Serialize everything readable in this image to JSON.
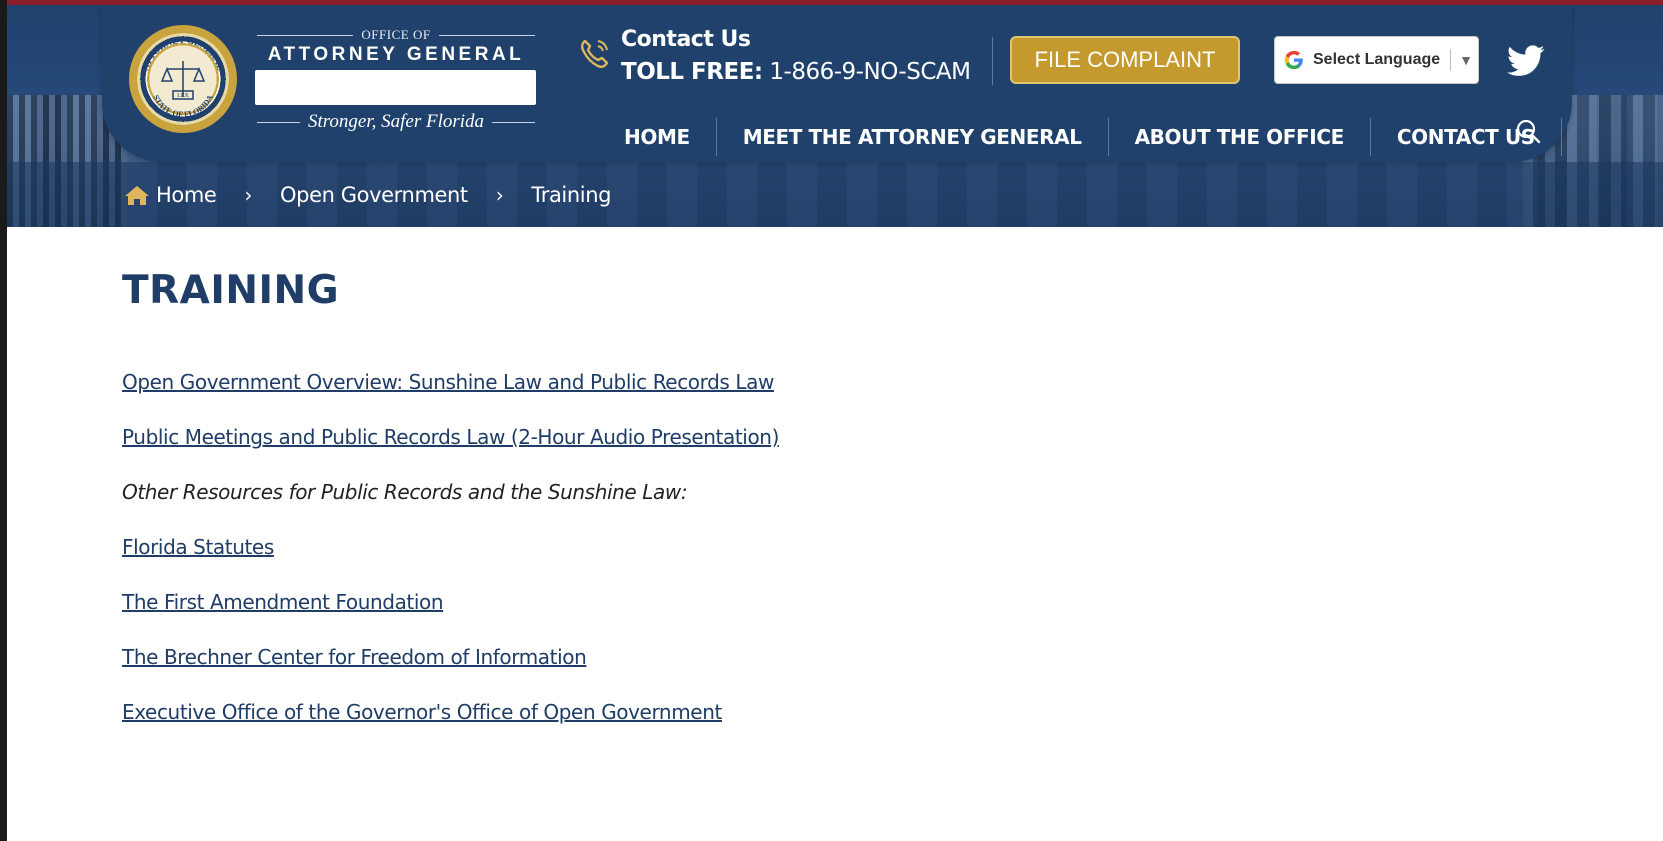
{
  "brand": {
    "office_of": "OFFICE OF",
    "title": "ATTORNEY GENERAL",
    "tagline": "Stronger, Safer Florida",
    "seal_top_text": "ATTORNEY GENERAL",
    "seal_bottom_text": "STATE OF FLORIDA",
    "seal_center_text": "LEX"
  },
  "contact": {
    "label": "Contact Us",
    "toll_prefix": "TOLL FREE:",
    "toll_number": "1-866-9-NO-SCAM"
  },
  "actions": {
    "file_complaint": "FILE COMPLAINT",
    "select_language": "Select Language",
    "language_arrow": "▼"
  },
  "nav": {
    "items": [
      "HOME",
      "MEET THE ATTORNEY GENERAL",
      "ABOUT THE OFFICE",
      "CONTACT US"
    ]
  },
  "breadcrumb": {
    "items": [
      "Home",
      "Open Government",
      "Training"
    ],
    "separator": "›"
  },
  "page": {
    "title": "TRAINING",
    "links": [
      "Open Government Overview: Sunshine Law and Public Records Law",
      "Public Meetings and Public Records Law (2-Hour Audio Presentation)"
    ],
    "note": "Other Resources for Public Records and the Sunshine Law:",
    "resources": [
      "Florida Statutes",
      "The First Amendment Foundation",
      "The Brechner Center for Freedom of Information",
      "Executive Office of the Governor's Office of Open Government"
    ]
  },
  "colors": {
    "navy": "#1f416c",
    "gold": "#c49a2e",
    "link": "#1f3d66",
    "top_accent": "#8a1f2b"
  },
  "icons": [
    "phone-icon",
    "google-g-icon",
    "twitter-icon",
    "search-icon",
    "home-icon",
    "chevron-right-icon"
  ]
}
